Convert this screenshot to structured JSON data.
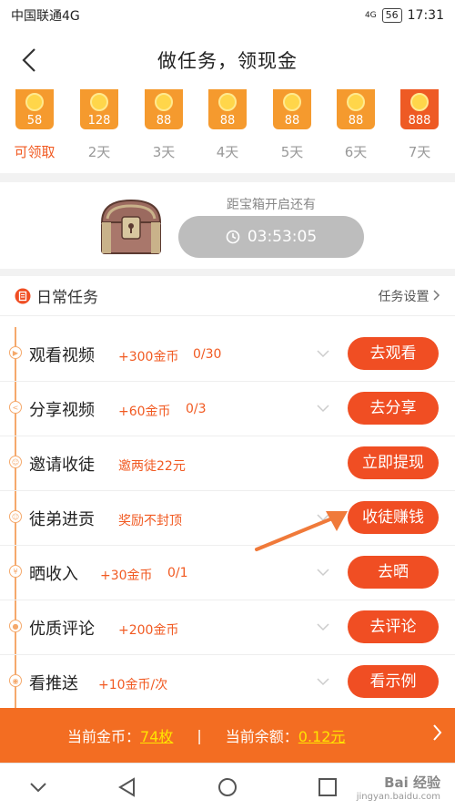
{
  "status_bar": {
    "carrier": "中国联通4G",
    "net": "4G",
    "battery": "56",
    "time": "17:31"
  },
  "header": {
    "title": "做任务，领现金"
  },
  "checkin": {
    "days": [
      {
        "value": "58",
        "label": "可领取"
      },
      {
        "value": "128",
        "label": "2天"
      },
      {
        "value": "88",
        "label": "3天"
      },
      {
        "value": "88",
        "label": "4天"
      },
      {
        "value": "88",
        "label": "5天"
      },
      {
        "value": "88",
        "label": "6天"
      },
      {
        "value": "888",
        "label": "7天"
      }
    ]
  },
  "chest": {
    "caption": "距宝箱开启还有",
    "countdown": "03:53:05"
  },
  "daily": {
    "title": "日常任务",
    "settings": "任务设置",
    "tasks": [
      {
        "name": "观看视频",
        "reward": "+300金币",
        "progress": "0/30",
        "button": "去观看"
      },
      {
        "name": "分享视频",
        "reward": "+60金币",
        "progress": "0/3",
        "button": "去分享"
      },
      {
        "name": "邀请收徒",
        "reward": "邀两徒22元",
        "progress": "",
        "button": "立即提现"
      },
      {
        "name": "徒弟进贡",
        "reward": "奖励不封顶",
        "progress": "",
        "button": "收徒赚钱"
      },
      {
        "name": "晒收入",
        "reward": "+30金币",
        "progress": "0/1",
        "button": "去晒"
      },
      {
        "name": "优质评论",
        "reward": "+200金币",
        "progress": "",
        "button": "去评论"
      },
      {
        "name": "看推送",
        "reward": "+10金币/次",
        "progress": "",
        "button": "看示例"
      }
    ]
  },
  "footer": {
    "coins_label": "当前金币：",
    "coins_value": "74枚",
    "separator": "|",
    "balance_label": "当前余额：",
    "balance_value": "0.12元"
  },
  "watermark": {
    "brand": "Bai 经验",
    "url": "jingyan.baidu.com"
  },
  "colors": {
    "accent": "#f04e23",
    "coin_box": "#f59a2e",
    "footer_bg": "#f36d22",
    "highlight": "#ffe400"
  }
}
